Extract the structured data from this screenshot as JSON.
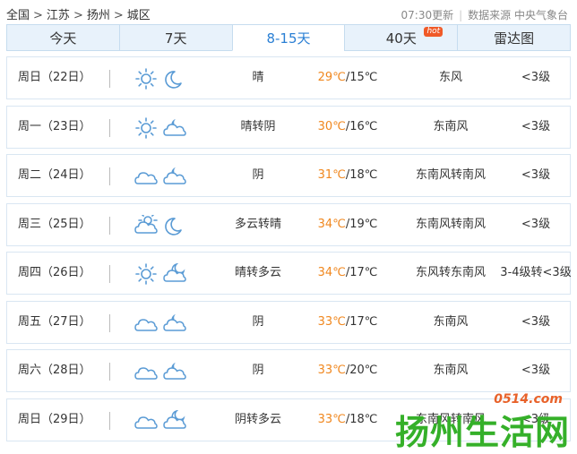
{
  "breadcrumb": {
    "items": [
      "全国",
      "江苏",
      "扬州",
      "城区"
    ],
    "separator": ">"
  },
  "meta": {
    "update_time": "07:30更新",
    "source": "数据来源 中央气象台"
  },
  "tabs": [
    {
      "label": "今天",
      "active": false
    },
    {
      "label": "7天",
      "active": false
    },
    {
      "label": "8-15天",
      "active": true
    },
    {
      "label": "40天",
      "active": false,
      "badge": "hot"
    },
    {
      "label": "雷达图",
      "active": false
    }
  ],
  "forecast": [
    {
      "day": "周日（22日）",
      "icon1": "sun-icon",
      "icon2": "moon-icon",
      "condition": "晴",
      "high": "29℃",
      "low": "/15℃",
      "wind": "东风",
      "level": "<3级"
    },
    {
      "day": "周一（23日）",
      "icon1": "sun-icon",
      "icon2": "cloudy-night-icon",
      "condition": "晴转阴",
      "high": "30℃",
      "low": "/16℃",
      "wind": "东南风",
      "level": "<3级"
    },
    {
      "day": "周二（24日）",
      "icon1": "overcast-icon",
      "icon2": "cloudy-night-icon",
      "condition": "阴",
      "high": "31℃",
      "low": "/18℃",
      "wind": "东南风转南风",
      "level": "<3级"
    },
    {
      "day": "周三（25日）",
      "icon1": "partly-cloudy-icon",
      "icon2": "moon-icon",
      "condition": "多云转晴",
      "high": "34℃",
      "low": "/19℃",
      "wind": "东南风转南风",
      "level": "<3级"
    },
    {
      "day": "周四（26日）",
      "icon1": "sun-icon",
      "icon2": "partly-cloudy-night-icon",
      "condition": "晴转多云",
      "high": "34℃",
      "low": "/17℃",
      "wind": "东风转东南风",
      "level": "3-4级转<3级"
    },
    {
      "day": "周五（27日）",
      "icon1": "overcast-icon",
      "icon2": "cloudy-night-icon",
      "condition": "阴",
      "high": "33℃",
      "low": "/17℃",
      "wind": "东南风",
      "level": "<3级"
    },
    {
      "day": "周六（28日）",
      "icon1": "overcast-icon",
      "icon2": "cloudy-night-icon",
      "condition": "阴",
      "high": "33℃",
      "low": "/20℃",
      "wind": "东南风",
      "level": "<3级"
    },
    {
      "day": "周日（29日）",
      "icon1": "overcast-icon",
      "icon2": "partly-cloudy-night-icon",
      "condition": "阴转多云",
      "high": "33℃",
      "low": "/18℃",
      "wind": "东南风转南风",
      "level": "<3级"
    }
  ],
  "watermark": {
    "site": "0514.com",
    "text": "扬州生活网"
  },
  "colors": {
    "accent": "#2a7fd4",
    "high_temp": "#f0871e",
    "icon": "#5a9bd5"
  }
}
